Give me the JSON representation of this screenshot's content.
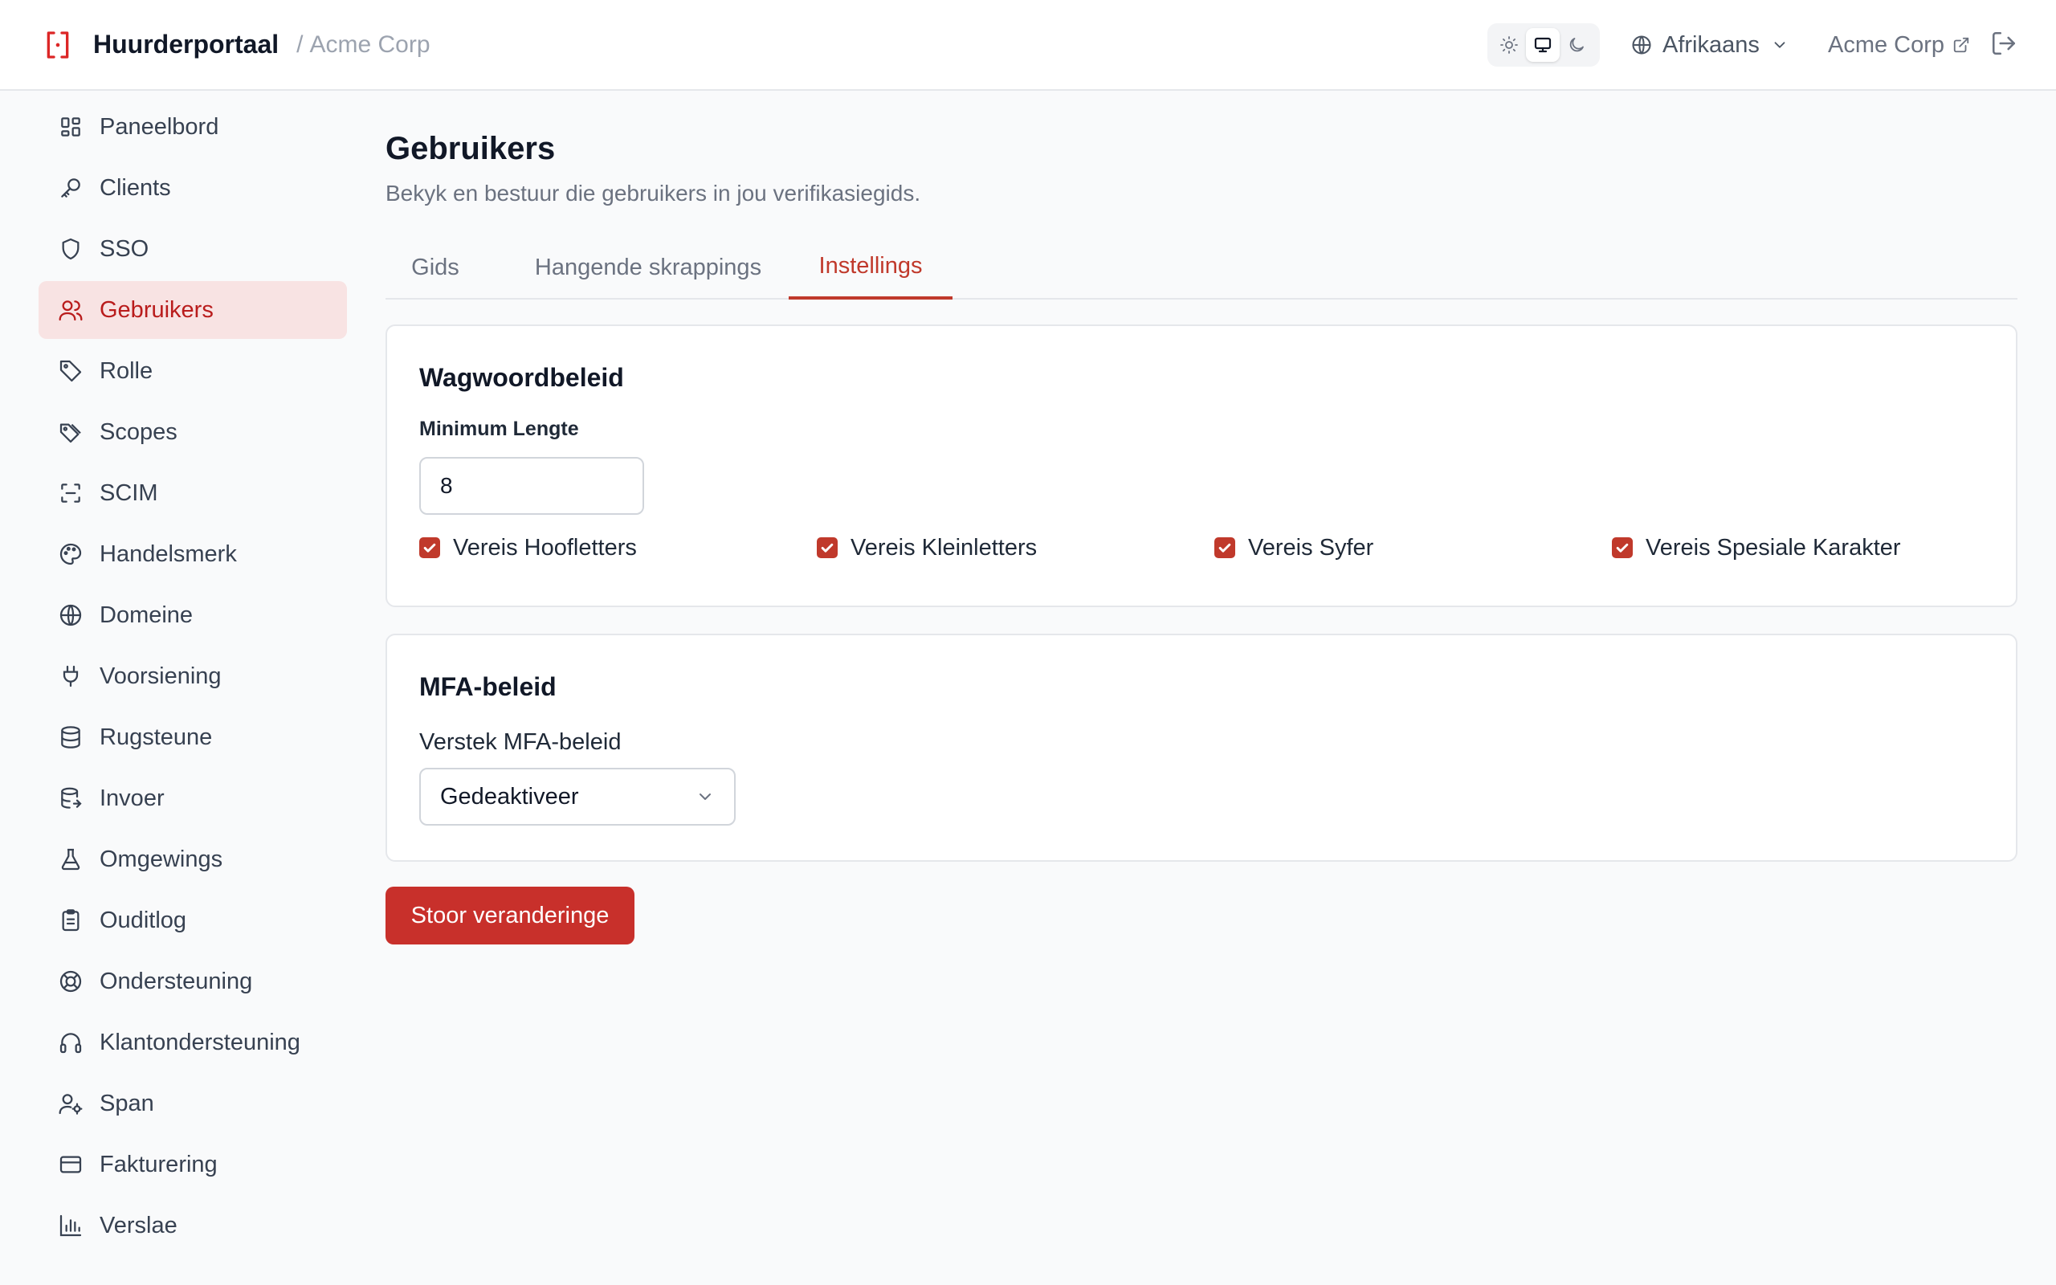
{
  "header": {
    "app_name": "Huurderportaal",
    "separator": "/",
    "tenant": "Acme Corp",
    "theme": {
      "options": [
        "light",
        "system",
        "dark"
      ],
      "active": "system"
    },
    "language": {
      "icon": "globe-icon",
      "label": "Afrikaans"
    },
    "tenant_link": {
      "label": "Acme Corp",
      "icon": "external-link-icon"
    },
    "logout_icon": "logout-icon"
  },
  "sidebar": {
    "items": [
      {
        "label": "Paneelbord",
        "icon": "dashboard-icon",
        "active": false
      },
      {
        "label": "Clients",
        "icon": "key-icon",
        "active": false
      },
      {
        "label": "SSO",
        "icon": "shield-icon",
        "active": false
      },
      {
        "label": "Gebruikers",
        "icon": "users-icon",
        "active": true
      },
      {
        "label": "Rolle",
        "icon": "tag-icon",
        "active": false
      },
      {
        "label": "Scopes",
        "icon": "tags-icon",
        "active": false
      },
      {
        "label": "SCIM",
        "icon": "scan-icon",
        "active": false
      },
      {
        "label": "Handelsmerk",
        "icon": "palette-icon",
        "active": false
      },
      {
        "label": "Domeine",
        "icon": "globe-icon",
        "active": false
      },
      {
        "label": "Voorsiening",
        "icon": "plug-icon",
        "active": false
      },
      {
        "label": "Rugsteune",
        "icon": "database-icon",
        "active": false
      },
      {
        "label": "Invoer",
        "icon": "database-import-icon",
        "active": false
      },
      {
        "label": "Omgewings",
        "icon": "flask-icon",
        "active": false
      },
      {
        "label": "Ouditlog",
        "icon": "clipboard-list-icon",
        "active": false
      },
      {
        "label": "Ondersteuning",
        "icon": "life-buoy-icon",
        "active": false
      },
      {
        "label": "Klantondersteuning",
        "icon": "headphones-icon",
        "active": false
      },
      {
        "label": "Span",
        "icon": "user-cog-icon",
        "active": false
      },
      {
        "label": "Fakturering",
        "icon": "credit-card-icon",
        "active": false
      },
      {
        "label": "Verslae",
        "icon": "bar-chart-icon",
        "active": false
      }
    ]
  },
  "main": {
    "title": "Gebruikers",
    "description": "Bekyk en bestuur die gebruikers in jou verifikasiegids.",
    "tabs": [
      {
        "label": "Gids",
        "active": false
      },
      {
        "label": "Hangende skrappings",
        "active": false
      },
      {
        "label": "Instellings",
        "active": true
      }
    ],
    "password_policy": {
      "title": "Wagwoordbeleid",
      "min_length_label": "Minimum Lengte",
      "min_length_value": "8",
      "checks": [
        {
          "label": "Vereis Hoofletters",
          "checked": true
        },
        {
          "label": "Vereis Kleinletters",
          "checked": true
        },
        {
          "label": "Vereis Syfer",
          "checked": true
        },
        {
          "label": "Vereis Spesiale Karakter",
          "checked": true
        }
      ]
    },
    "mfa_policy": {
      "title": "MFA-beleid",
      "default_label": "Verstek MFA-beleid",
      "default_value": "Gedeaktiveer"
    },
    "save_label": "Stoor veranderinge"
  },
  "colors": {
    "accent": "#c0392b",
    "active_nav_bg": "#f8e3e3",
    "background": "#f9fafb"
  }
}
